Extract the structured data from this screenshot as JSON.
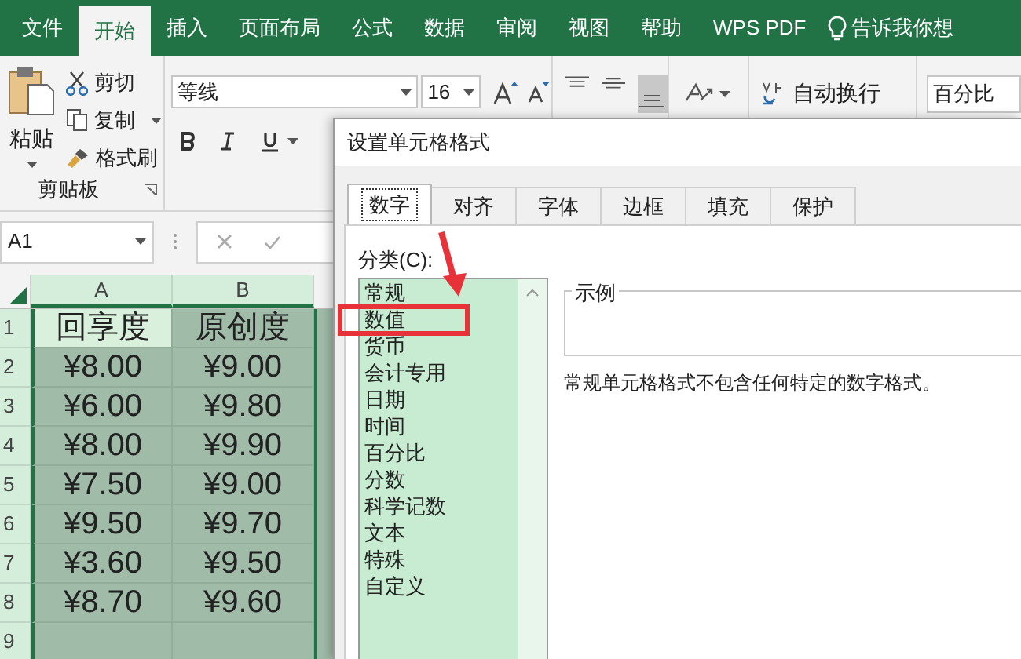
{
  "ribbon_tabs": [
    {
      "label": "文件",
      "selected": false
    },
    {
      "label": "开始",
      "selected": true
    },
    {
      "label": "插入",
      "selected": false
    },
    {
      "label": "页面布局",
      "selected": false
    },
    {
      "label": "公式",
      "selected": false
    },
    {
      "label": "数据",
      "selected": false
    },
    {
      "label": "审阅",
      "selected": false
    },
    {
      "label": "视图",
      "selected": false
    },
    {
      "label": "帮助",
      "selected": false
    },
    {
      "label": "WPS PDF",
      "selected": false
    }
  ],
  "tell_me": "告诉我你想",
  "clipboard": {
    "paste": "粘贴",
    "cut": "剪切",
    "copy": "复制",
    "format_painter": "格式刷",
    "group_label": "剪贴板"
  },
  "font": {
    "name": "等线",
    "size": "16"
  },
  "wrap_text": "自动换行",
  "number_format": "百分比",
  "name_box": "A1",
  "sheet": {
    "columns": [
      "A",
      "B"
    ],
    "rows": [
      {
        "number": "1",
        "cells": [
          {
            "text": "回享度",
            "active": true
          },
          {
            "text": "原创度",
            "active": false
          }
        ]
      },
      {
        "number": "2",
        "cells": [
          {
            "text": "¥8.00",
            "active": false
          },
          {
            "text": "¥9.00",
            "active": false
          }
        ]
      },
      {
        "number": "3",
        "cells": [
          {
            "text": "¥6.00",
            "active": false
          },
          {
            "text": "¥9.80",
            "active": false
          }
        ]
      },
      {
        "number": "4",
        "cells": [
          {
            "text": "¥8.00",
            "active": false
          },
          {
            "text": "¥9.90",
            "active": false
          }
        ]
      },
      {
        "number": "5",
        "cells": [
          {
            "text": "¥7.50",
            "active": false
          },
          {
            "text": "¥9.00",
            "active": false
          }
        ]
      },
      {
        "number": "6",
        "cells": [
          {
            "text": "¥9.50",
            "active": false
          },
          {
            "text": "¥9.70",
            "active": false
          }
        ]
      },
      {
        "number": "7",
        "cells": [
          {
            "text": "¥3.60",
            "active": false
          },
          {
            "text": "¥9.50",
            "active": false
          }
        ]
      },
      {
        "number": "8",
        "cells": [
          {
            "text": "¥8.70",
            "active": false
          },
          {
            "text": "¥9.60",
            "active": false
          }
        ]
      },
      {
        "number": "9",
        "cells": [
          {
            "active": false
          },
          {
            "active": false
          }
        ]
      }
    ]
  },
  "dialog": {
    "title": "设置单元格格式",
    "tabs": [
      {
        "label": "数字",
        "selected": true
      },
      {
        "label": "对齐",
        "selected": false
      },
      {
        "label": "字体",
        "selected": false
      },
      {
        "label": "边框",
        "selected": false
      },
      {
        "label": "填充",
        "selected": false
      },
      {
        "label": "保护",
        "selected": false
      }
    ],
    "category_label": "分类(C):",
    "categories": [
      "常规",
      "数值",
      "货币",
      "会计专用",
      "日期",
      "时间",
      "百分比",
      "分数",
      "科学记数",
      "文本",
      "特殊",
      "自定义"
    ],
    "sample_label": "示例",
    "description": "常规单元格格式不包含任何特定的数字格式。"
  }
}
